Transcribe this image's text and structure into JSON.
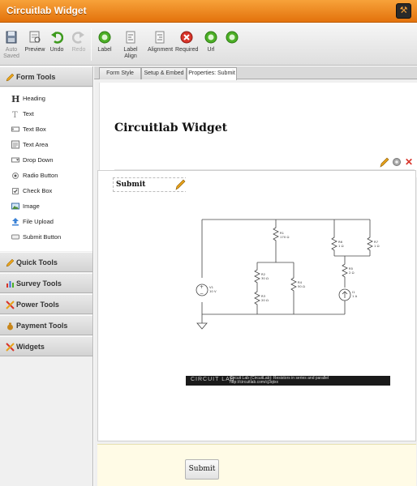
{
  "window": {
    "title": "Circuitlab Widget"
  },
  "toolbar": {
    "auto_saved": "Auto Saved",
    "preview": "Preview",
    "undo": "Undo",
    "redo": "Redo",
    "label": "Label",
    "label_align": "Label Align",
    "alignment": "Alignment",
    "required": "Required",
    "url": "Url"
  },
  "sidebar": {
    "form_tools": "Form Tools",
    "tools": [
      {
        "label": "Heading",
        "icon": "heading-icon"
      },
      {
        "label": "Text",
        "icon": "text-icon"
      },
      {
        "label": "Text Box",
        "icon": "textbox-icon"
      },
      {
        "label": "Text Area",
        "icon": "textarea-icon"
      },
      {
        "label": "Drop Down",
        "icon": "dropdown-icon"
      },
      {
        "label": "Radio Button",
        "icon": "radio-icon"
      },
      {
        "label": "Check Box",
        "icon": "checkbox-icon"
      },
      {
        "label": "Image",
        "icon": "image-icon"
      },
      {
        "label": "File Upload",
        "icon": "upload-icon"
      },
      {
        "label": "Submit Button",
        "icon": "submit-icon"
      }
    ],
    "quick_tools": "Quick Tools",
    "survey_tools": "Survey Tools",
    "power_tools": "Power Tools",
    "payment_tools": "Payment Tools",
    "widgets": "Widgets"
  },
  "tabs": [
    "Form Style",
    "Setup & Embed",
    "Properties: Submit"
  ],
  "form": {
    "title": "Circuitlab Widget",
    "field_label": "Submit",
    "submit_label": "Submit"
  },
  "circuit": {
    "r1": "R1",
    "r1v": "170 Ω",
    "r2": "R2",
    "r2v": "30 Ω",
    "r3": "R3",
    "r3v": "20 Ω",
    "r4": "R4",
    "r4v": "50 Ω",
    "r5": "R5",
    "r5v": "2 Ω",
    "r6": "R6",
    "r6v": "1 Ω",
    "r7": "R7",
    "r7v": "1 Ω",
    "v1": "V1",
    "v1v": "10 V",
    "i1": "I1",
    "i1v": "1 A",
    "footer_logo": "CIRCUIT LAB",
    "footer_line1": "Circuit Lab (CircuitLab): Resistors in series and parallel",
    "footer_line2": "http://circuitlab.com/cj3qtxx"
  },
  "colors": {
    "accent": "#e8800f",
    "green": "#4caf26",
    "red": "#d8342a"
  }
}
